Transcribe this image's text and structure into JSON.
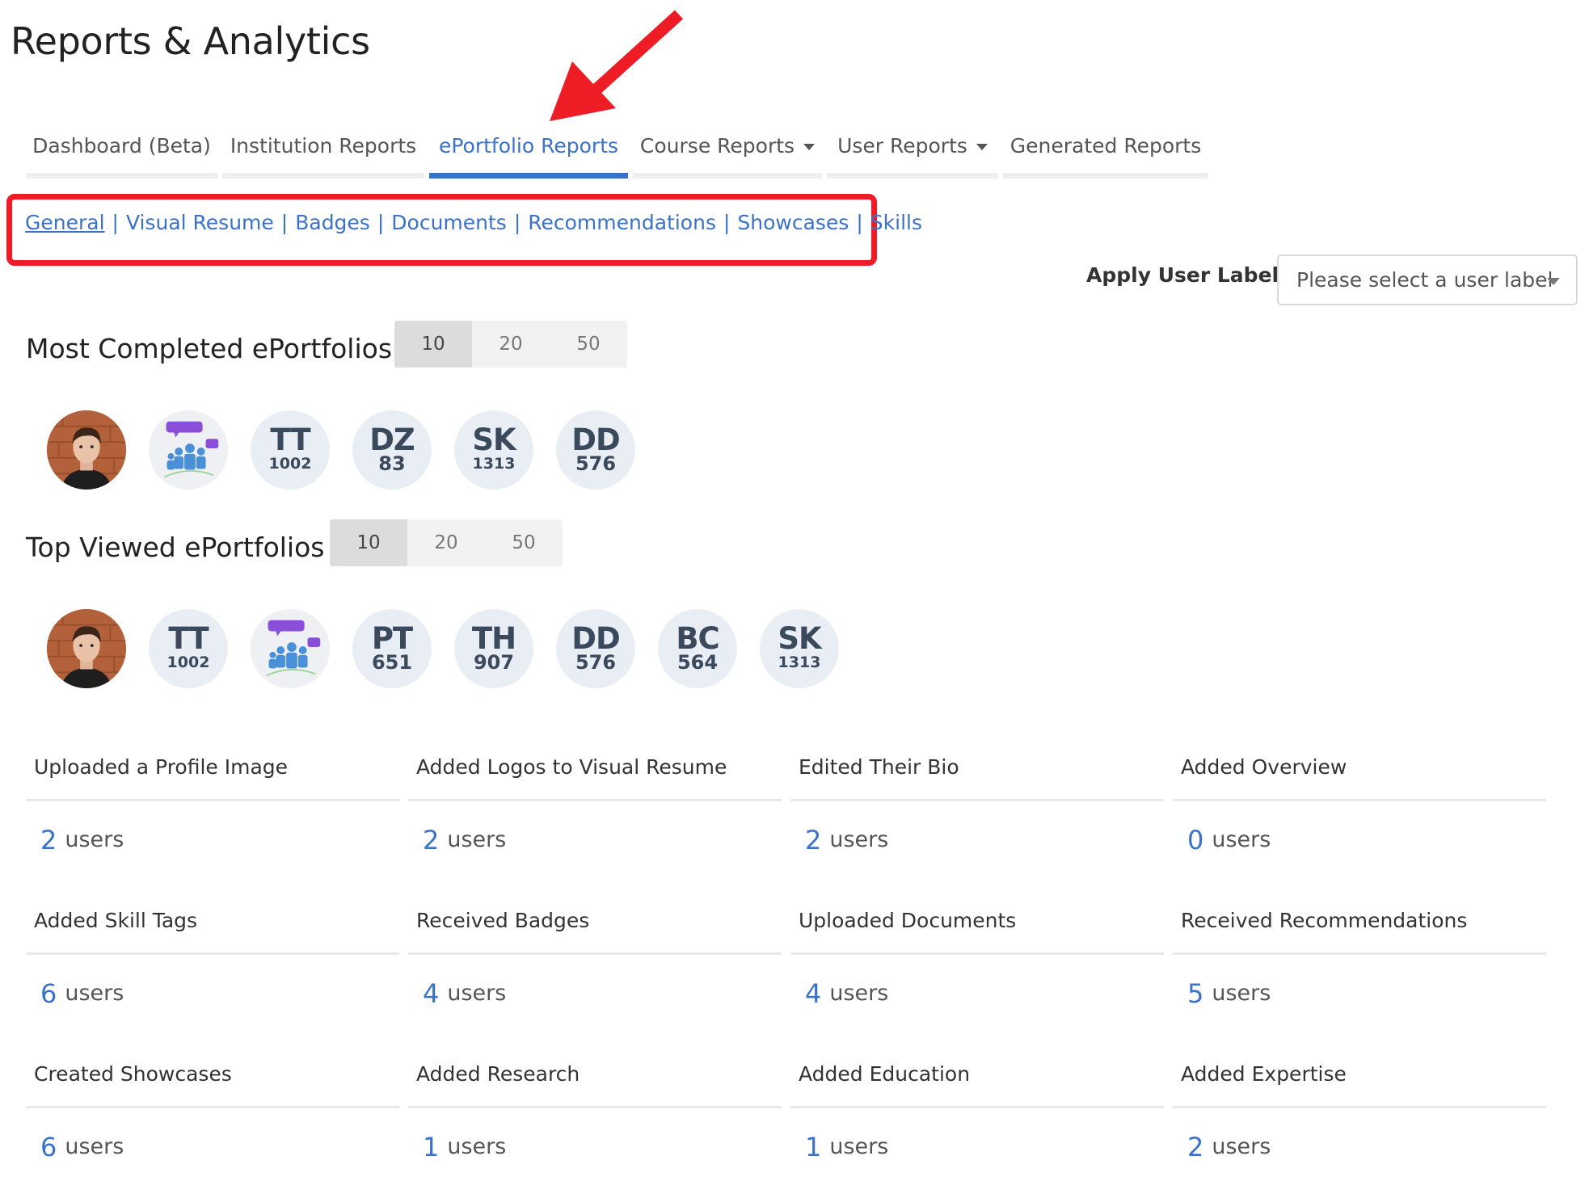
{
  "page": {
    "title": "Reports & Analytics"
  },
  "tabs": [
    {
      "label": "Dashboard (Beta)",
      "active": false,
      "dropdown": false
    },
    {
      "label": "Institution Reports",
      "active": false,
      "dropdown": false
    },
    {
      "label": "ePortfolio Reports",
      "active": true,
      "dropdown": false
    },
    {
      "label": "Course Reports",
      "active": false,
      "dropdown": true
    },
    {
      "label": "User Reports",
      "active": false,
      "dropdown": true
    },
    {
      "label": "Generated Reports",
      "active": false,
      "dropdown": false
    }
  ],
  "subnav": [
    "General",
    "Visual Resume",
    "Badges",
    "Documents",
    "Recommendations",
    "Showcases",
    "Skills"
  ],
  "user_labels": {
    "label": "Apply User Labels",
    "placeholder": "Please select a user label"
  },
  "most_completed": {
    "title": "Most Completed ePortfolios",
    "counts": [
      "10",
      "20",
      "50"
    ],
    "active_count": "10",
    "avatars": [
      {
        "type": "photo"
      },
      {
        "type": "group"
      },
      {
        "initials": "TT",
        "number": "1002"
      },
      {
        "initials": "DZ",
        "number": "83"
      },
      {
        "initials": "SK",
        "number": "1313"
      },
      {
        "initials": "DD",
        "number": "576"
      }
    ]
  },
  "top_viewed": {
    "title": "Top Viewed ePortfolios",
    "counts": [
      "10",
      "20",
      "50"
    ],
    "active_count": "10",
    "avatars": [
      {
        "type": "photo"
      },
      {
        "initials": "TT",
        "number": "1002"
      },
      {
        "type": "group"
      },
      {
        "initials": "PT",
        "number": "651"
      },
      {
        "initials": "TH",
        "number": "907"
      },
      {
        "initials": "DD",
        "number": "576"
      },
      {
        "initials": "BC",
        "number": "564"
      },
      {
        "initials": "SK",
        "number": "1313"
      }
    ]
  },
  "stats": [
    {
      "label": "Uploaded a Profile Image",
      "value": "2",
      "unit": "users"
    },
    {
      "label": "Added Logos to Visual Resume",
      "value": "2",
      "unit": "users"
    },
    {
      "label": "Edited Their Bio",
      "value": "2",
      "unit": "users"
    },
    {
      "label": "Added Overview",
      "value": "0",
      "unit": "users"
    },
    {
      "label": "Added Skill Tags",
      "value": "6",
      "unit": "users"
    },
    {
      "label": "Received Badges",
      "value": "4",
      "unit": "users"
    },
    {
      "label": "Uploaded Documents",
      "value": "4",
      "unit": "users"
    },
    {
      "label": "Received Recommendations",
      "value": "5",
      "unit": "users"
    },
    {
      "label": "Created Showcases",
      "value": "6",
      "unit": "users"
    },
    {
      "label": "Added Research",
      "value": "1",
      "unit": "users"
    },
    {
      "label": "Added Education",
      "value": "1",
      "unit": "users"
    },
    {
      "label": "Added Expertise",
      "value": "2",
      "unit": "users"
    }
  ],
  "colors": {
    "accent": "#3a72c9",
    "annotation": "#ee1c25"
  }
}
